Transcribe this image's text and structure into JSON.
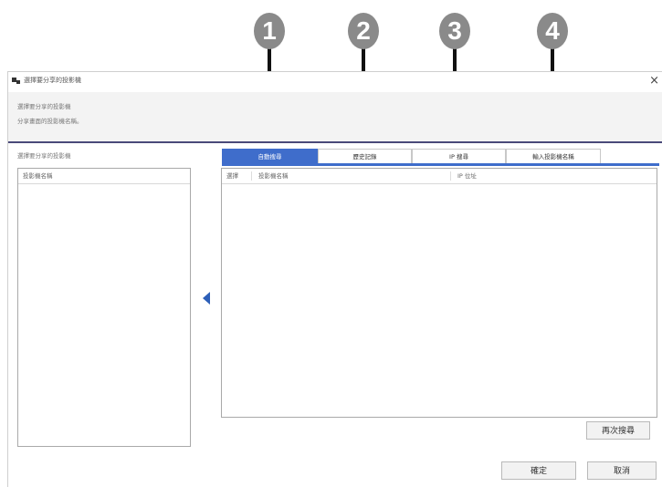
{
  "callouts": [
    "1",
    "2",
    "3",
    "4"
  ],
  "window": {
    "title": "選擇要分享的投影機",
    "close_label": "×"
  },
  "header": {
    "line1": "選擇要分享的投影機",
    "line2": "分享畫面的投影機名稱。"
  },
  "left_panel": {
    "caption": "選擇要分享的投影機",
    "column": "投影機名稱"
  },
  "tabs": [
    {
      "label": "自動搜尋",
      "active": true
    },
    {
      "label": "歷史記錄",
      "active": false
    },
    {
      "label": "IP 搜尋",
      "active": false
    },
    {
      "label": "輸入投影機名稱",
      "active": false
    }
  ],
  "table": {
    "columns": [
      "選擇",
      "投影機名稱",
      "IP 位址"
    ]
  },
  "buttons": {
    "search_again": "再次搜尋",
    "ok": "確定",
    "cancel": "取消"
  },
  "colors": {
    "accent": "#3f6dcb",
    "callout": "#8a8a8a"
  }
}
